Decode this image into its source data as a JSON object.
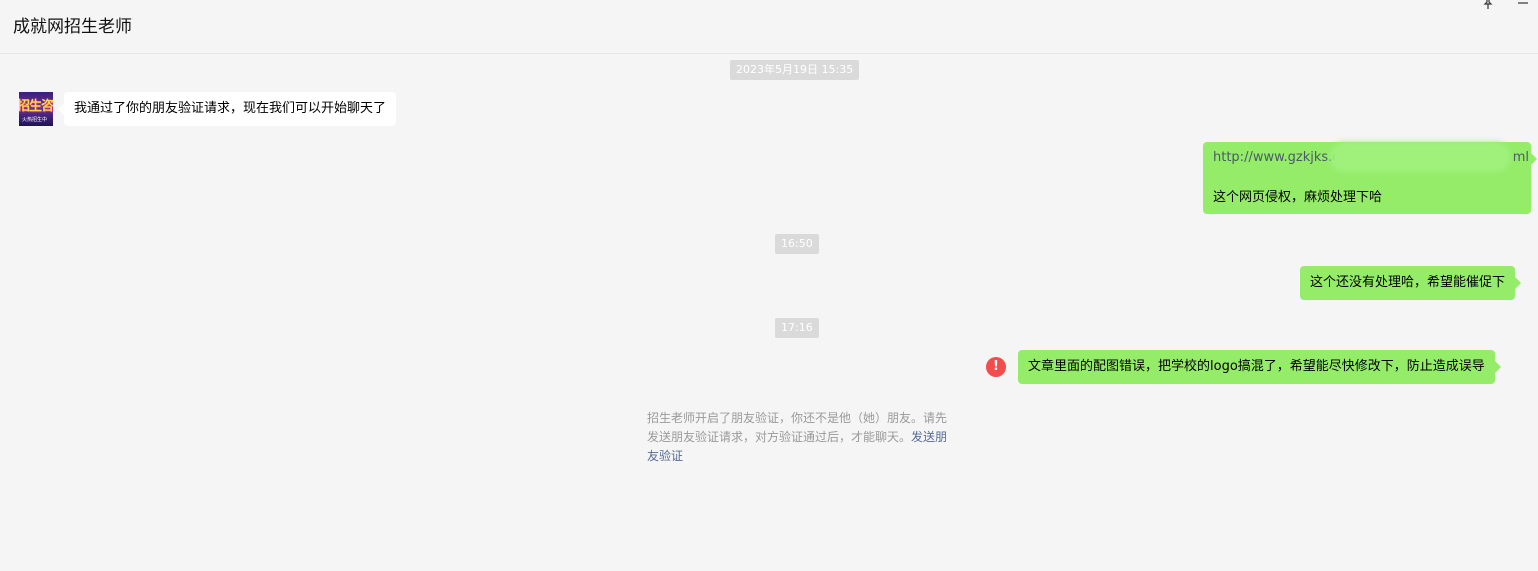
{
  "header": {
    "title": "成就网招生老师",
    "pin_icon": "pin-icon",
    "minimize_icon": "minimize-icon"
  },
  "messages": {
    "ts1": "2023年5月19日 15:35",
    "ts2": "16:50",
    "ts3": "17:16",
    "incoming_1": "我通过了你的朋友验证请求，现在我们可以开始聊天了",
    "outgoing_1_line1": "http://www.gzkjks.com/...ml",
    "outgoing_1_line1_prefix": "http://www.gzkjks.cor",
    "outgoing_1_line1_suffix": "ml",
    "outgoing_1_line2": "这个网页侵权，麻烦处理下哈",
    "outgoing_2": "这个还没有处理哈，希望能催促下",
    "outgoing_3": "文章里面的配图错误，把学校的logo搞混了，希望能尽快修改下，防止造成误导"
  },
  "avatar": {
    "big_text": "招生咨",
    "small_text": "火热招生中"
  },
  "system_note": {
    "text": "招生老师开启了朋友验证，你还不是他（她）朋友。请先发送朋友验证请求，对方验证通过后，才能聊天。",
    "link": "发送朋友验证"
  },
  "error_icon": {
    "glyph": "!",
    "color": "#f24c4c"
  },
  "colors": {
    "background": "#f5f5f5",
    "outgoing_bubble": "#95ec69",
    "incoming_bubble": "#ffffff",
    "link": "#576b95"
  }
}
